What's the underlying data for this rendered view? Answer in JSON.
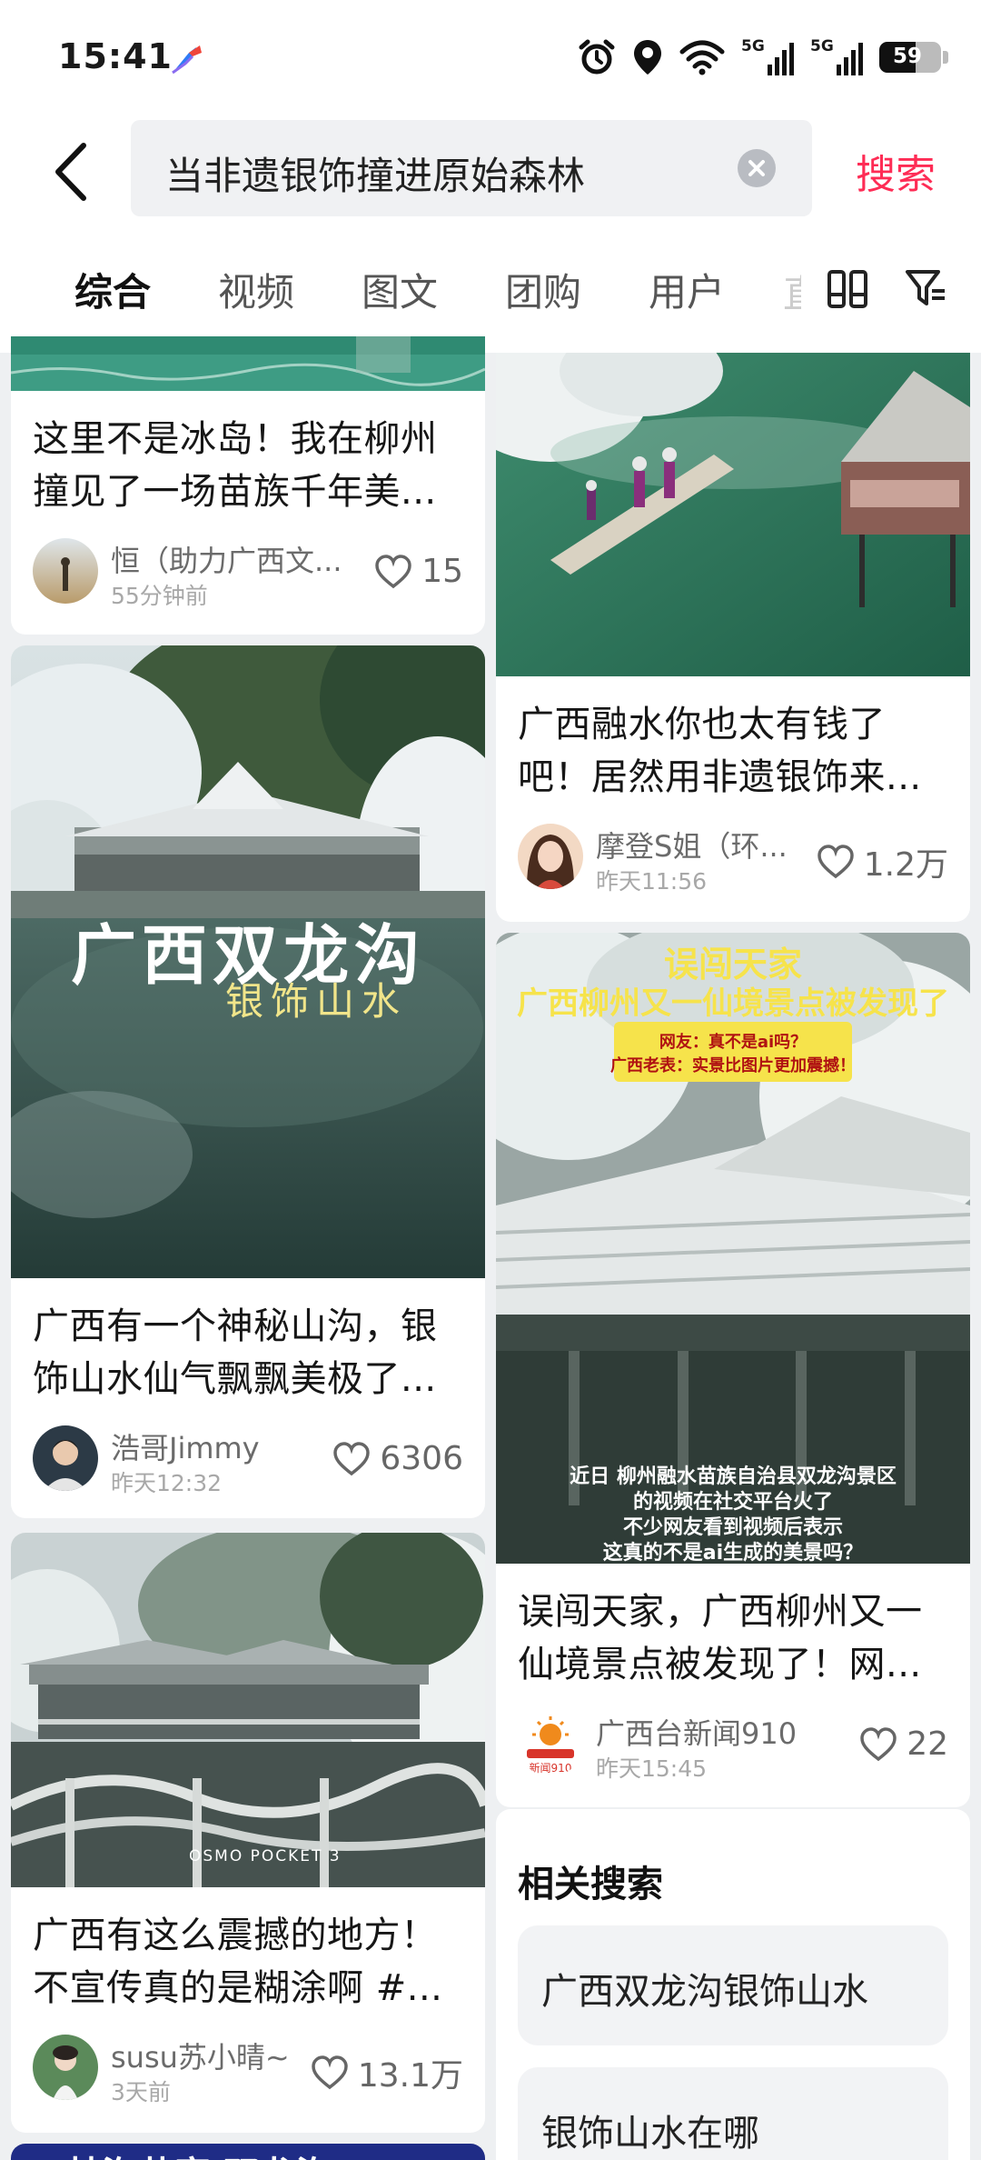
{
  "status_bar": {
    "time": "15:41",
    "app_icon": "feather-app-icon",
    "icons": [
      "alarm-icon",
      "location-icon",
      "wifi-icon",
      "signal-5g-icon",
      "signal-5g-icon",
      "battery-icon"
    ],
    "signal_label": "5G",
    "battery_percent": "59",
    "battery_level": 0.59
  },
  "search": {
    "query": "当非遗银饰撞进原始森林",
    "submit_label": "搜索",
    "accent_color": "#fe2c55"
  },
  "tabs": [
    {
      "label": "综合",
      "active": true
    },
    {
      "label": "视频",
      "active": false
    },
    {
      "label": "图文",
      "active": false
    },
    {
      "label": "团购",
      "active": false
    },
    {
      "label": "用户",
      "active": false
    }
  ],
  "tab_truncated": "直",
  "cards": [
    {
      "title": "这里不是冰岛！我在柳州撞见了一场苗族千年美...",
      "author": "恒（助力广西文...",
      "time": "55分钟前",
      "likes": "15"
    },
    {
      "title": "广西有一个神秘山沟，银饰山水仙气飘飘美极了...",
      "author": "浩哥Jimmy",
      "time": "昨天12:32",
      "likes": "6306",
      "overlay_title": "广西双龙沟",
      "overlay_subtitle": "银饰山水"
    },
    {
      "title": "广西有这么震撼的地方！不宣传真的是糊涂啊 #...",
      "author": "susu苏小晴~",
      "time": "3天前",
      "likes": "13.1万",
      "watermark": "OSMO POCKET 3"
    },
    {
      "title": "广西融水你也太有钱了吧！居然用非遗银饰来...",
      "author": "摩登S姐（环...",
      "time": "昨天11:56",
      "likes": "1.2万"
    },
    {
      "title": "误闯天家，广西柳州又一仙境景点被发现了！网...",
      "author": "广西台新闻910",
      "time": "昨天15:45",
      "likes": "22",
      "avatar_text": "新闻910",
      "overlay_head1": "误闯天家",
      "overlay_head2": "广西柳州又一仙境景点被发现了",
      "overlay_note1": "网友：真不是ai吗？",
      "overlay_note2": "广西老表：实景比图片更加震撼！",
      "overlay_caption1": "近日 柳州融水苗族自治县双龙沟景区",
      "overlay_caption2": "的视频在社交平台火了",
      "overlay_caption3": "不少网友看到视频后表示",
      "overlay_caption4": "这真的不是ai生成的美景吗？"
    }
  ],
  "bottom_partial_title": "林海苗家 双龙沟",
  "related": {
    "title": "相关搜索",
    "items": [
      "广西双龙沟银饰山水",
      "银饰山水在哪"
    ]
  }
}
